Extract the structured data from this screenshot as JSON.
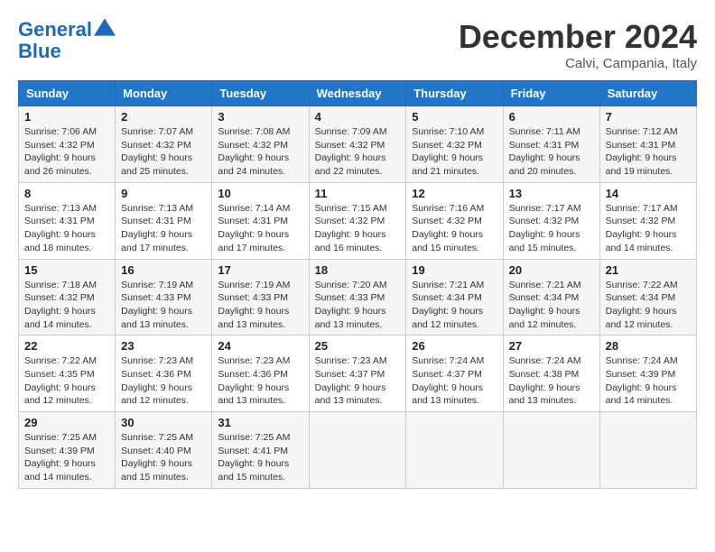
{
  "header": {
    "logo_line1": "General",
    "logo_line2": "Blue",
    "month_year": "December 2024",
    "location": "Calvi, Campania, Italy"
  },
  "days_of_week": [
    "Sunday",
    "Monday",
    "Tuesday",
    "Wednesday",
    "Thursday",
    "Friday",
    "Saturday"
  ],
  "weeks": [
    [
      {
        "day": "1",
        "sunrise": "7:06 AM",
        "sunset": "4:32 PM",
        "daylight": "9 hours and 26 minutes."
      },
      {
        "day": "2",
        "sunrise": "7:07 AM",
        "sunset": "4:32 PM",
        "daylight": "9 hours and 25 minutes."
      },
      {
        "day": "3",
        "sunrise": "7:08 AM",
        "sunset": "4:32 PM",
        "daylight": "9 hours and 24 minutes."
      },
      {
        "day": "4",
        "sunrise": "7:09 AM",
        "sunset": "4:32 PM",
        "daylight": "9 hours and 22 minutes."
      },
      {
        "day": "5",
        "sunrise": "7:10 AM",
        "sunset": "4:32 PM",
        "daylight": "9 hours and 21 minutes."
      },
      {
        "day": "6",
        "sunrise": "7:11 AM",
        "sunset": "4:31 PM",
        "daylight": "9 hours and 20 minutes."
      },
      {
        "day": "7",
        "sunrise": "7:12 AM",
        "sunset": "4:31 PM",
        "daylight": "9 hours and 19 minutes."
      }
    ],
    [
      {
        "day": "8",
        "sunrise": "7:13 AM",
        "sunset": "4:31 PM",
        "daylight": "9 hours and 18 minutes."
      },
      {
        "day": "9",
        "sunrise": "7:13 AM",
        "sunset": "4:31 PM",
        "daylight": "9 hours and 17 minutes."
      },
      {
        "day": "10",
        "sunrise": "7:14 AM",
        "sunset": "4:31 PM",
        "daylight": "9 hours and 17 minutes."
      },
      {
        "day": "11",
        "sunrise": "7:15 AM",
        "sunset": "4:32 PM",
        "daylight": "9 hours and 16 minutes."
      },
      {
        "day": "12",
        "sunrise": "7:16 AM",
        "sunset": "4:32 PM",
        "daylight": "9 hours and 15 minutes."
      },
      {
        "day": "13",
        "sunrise": "7:17 AM",
        "sunset": "4:32 PM",
        "daylight": "9 hours and 15 minutes."
      },
      {
        "day": "14",
        "sunrise": "7:17 AM",
        "sunset": "4:32 PM",
        "daylight": "9 hours and 14 minutes."
      }
    ],
    [
      {
        "day": "15",
        "sunrise": "7:18 AM",
        "sunset": "4:32 PM",
        "daylight": "9 hours and 14 minutes."
      },
      {
        "day": "16",
        "sunrise": "7:19 AM",
        "sunset": "4:33 PM",
        "daylight": "9 hours and 13 minutes."
      },
      {
        "day": "17",
        "sunrise": "7:19 AM",
        "sunset": "4:33 PM",
        "daylight": "9 hours and 13 minutes."
      },
      {
        "day": "18",
        "sunrise": "7:20 AM",
        "sunset": "4:33 PM",
        "daylight": "9 hours and 13 minutes."
      },
      {
        "day": "19",
        "sunrise": "7:21 AM",
        "sunset": "4:34 PM",
        "daylight": "9 hours and 12 minutes."
      },
      {
        "day": "20",
        "sunrise": "7:21 AM",
        "sunset": "4:34 PM",
        "daylight": "9 hours and 12 minutes."
      },
      {
        "day": "21",
        "sunrise": "7:22 AM",
        "sunset": "4:34 PM",
        "daylight": "9 hours and 12 minutes."
      }
    ],
    [
      {
        "day": "22",
        "sunrise": "7:22 AM",
        "sunset": "4:35 PM",
        "daylight": "9 hours and 12 minutes."
      },
      {
        "day": "23",
        "sunrise": "7:23 AM",
        "sunset": "4:36 PM",
        "daylight": "9 hours and 12 minutes."
      },
      {
        "day": "24",
        "sunrise": "7:23 AM",
        "sunset": "4:36 PM",
        "daylight": "9 hours and 13 minutes."
      },
      {
        "day": "25",
        "sunrise": "7:23 AM",
        "sunset": "4:37 PM",
        "daylight": "9 hours and 13 minutes."
      },
      {
        "day": "26",
        "sunrise": "7:24 AM",
        "sunset": "4:37 PM",
        "daylight": "9 hours and 13 minutes."
      },
      {
        "day": "27",
        "sunrise": "7:24 AM",
        "sunset": "4:38 PM",
        "daylight": "9 hours and 13 minutes."
      },
      {
        "day": "28",
        "sunrise": "7:24 AM",
        "sunset": "4:39 PM",
        "daylight": "9 hours and 14 minutes."
      }
    ],
    [
      {
        "day": "29",
        "sunrise": "7:25 AM",
        "sunset": "4:39 PM",
        "daylight": "9 hours and 14 minutes."
      },
      {
        "day": "30",
        "sunrise": "7:25 AM",
        "sunset": "4:40 PM",
        "daylight": "9 hours and 15 minutes."
      },
      {
        "day": "31",
        "sunrise": "7:25 AM",
        "sunset": "4:41 PM",
        "daylight": "9 hours and 15 minutes."
      },
      null,
      null,
      null,
      null
    ]
  ],
  "labels": {
    "sunrise": "Sunrise:",
    "sunset": "Sunset:",
    "daylight": "Daylight:"
  }
}
